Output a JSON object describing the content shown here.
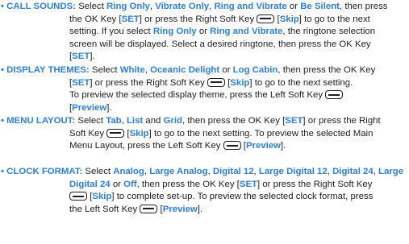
{
  "colors": {
    "accent": "#2e7fd6",
    "text": "#1f1f1f"
  },
  "icons": {
    "soft_key": "soft-key-icon"
  },
  "call_sounds": {
    "bullet": "•",
    "heading": "CALL SOUNDS:",
    "t_select": "Select",
    "ring_only": "Ring Only",
    "vibrate_only": "Vibrate Only",
    "ring_and_vibrate": "Ring and Vibrate",
    "be_silent": "Be Silent",
    "t_then": "then press",
    "t_ok_key": "the OK Key [",
    "set": "SET",
    "t_or_right": "] or press the Right Soft Key",
    "skip": "Skip",
    "t_to_next": "] to go to the next",
    "t_setting_if": "setting. If you select",
    "t_or": "or",
    "t_ringtone": ", the ringtone selection",
    "t_screen": "screen will be displayed. Select a desired ringtone, then press the OK Key",
    "t_close": "]."
  },
  "display_themes": {
    "bullet": "•",
    "heading": "DISPLAY THEMES:",
    "t_select": "Select",
    "white": "White",
    "oceanic_delight": "Oceanic Delight",
    "t_or": "or",
    "log_cabin": "Log Cabin",
    "t_then_ok": ", then press the OK Key",
    "set": "SET",
    "t_or_right": "] or press the Right Soft Key",
    "skip": "Skip",
    "t_to_next": "] to go to the next setting.",
    "t_to_preview": "To preview the selected display theme, press the Left Soft Key",
    "preview": "Preview",
    "t_close": "]."
  },
  "menu_layout": {
    "bullet": "•",
    "heading": "MENU LAYOUT:",
    "t_select": "Select",
    "tab": "Tab",
    "list": "List",
    "t_and": "and",
    "grid": "Grid",
    "t_then_ok": ", then press the OK Key [",
    "set": "SET",
    "t_or_right": "] or press the Right",
    "t_soft_key": "Soft Key",
    "skip": "Skip",
    "t_to_next": "] to go to the next setting. To preview the selected Main",
    "t_menu_layout": "Menu Layout, press the Left Soft Key",
    "preview": "Preview",
    "t_close": "]."
  },
  "clock_format": {
    "bullet": "•",
    "heading": "CLOCK FORMAT:",
    "t_select": "Select",
    "analog": "Analog",
    "large_analog": "Large Analog",
    "digital_12": "Digital 12",
    "large_digital_12": "Large Digital 12",
    "digital_24": "Digital 24",
    "large": "Large",
    "large_digital_24_rest": "Digital 24",
    "t_or": "or",
    "off": "Off",
    "t_then_ok": ", then press the OK Key [",
    "set": "SET",
    "t_or_right": "] or press the Right Soft Key",
    "skip": "Skip",
    "t_complete": "] to complete set-up. To preview the selected clock format, press",
    "t_the_left": "the Left Soft Key",
    "preview": "Preview",
    "t_close": "]."
  }
}
